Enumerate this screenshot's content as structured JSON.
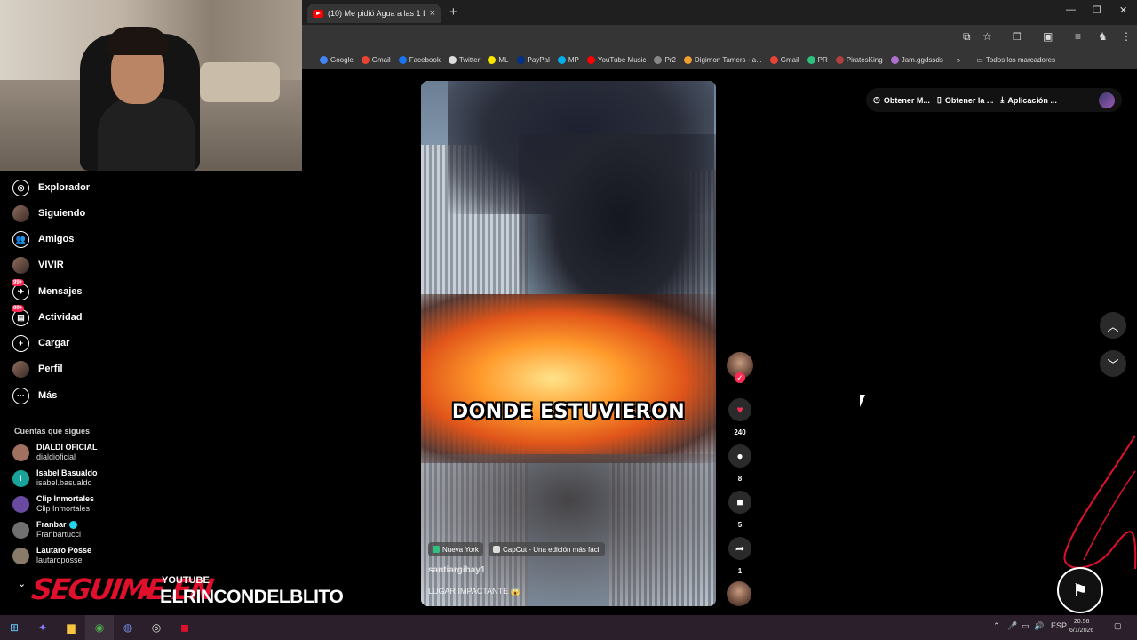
{
  "browser": {
    "tab_title": "(10) Me pidió Agua a las 1 De la",
    "tab_close": "×",
    "new_tab": "+",
    "window_controls": [
      "—",
      "❐",
      "✕"
    ],
    "bookmarks": [
      {
        "label": "Google",
        "color": "#4285f4"
      },
      {
        "label": "Gmail",
        "color": "#ea4335"
      },
      {
        "label": "Facebook",
        "color": "#1877f2"
      },
      {
        "label": "Twitter",
        "color": "#dddddd"
      },
      {
        "label": "ML",
        "color": "#ffe600"
      },
      {
        "label": "PayPal",
        "color": "#003087"
      },
      {
        "label": "MP",
        "color": "#00b1ea"
      },
      {
        "label": "YouTube Music",
        "color": "#ff0000"
      },
      {
        "label": "Pr2",
        "color": "#888888"
      },
      {
        "label": "Digimon Tamers - a...",
        "color": "#f0a030"
      },
      {
        "label": "Gmail",
        "color": "#ea4335"
      },
      {
        "label": "PR",
        "color": "#2ec27e"
      },
      {
        "label": "PiratesKing",
        "color": "#b04040"
      },
      {
        "label": "Jam.ggdssds",
        "color": "#b070d0"
      }
    ],
    "bookmarks_more": "»",
    "all_bookmarks": "Todos los marcadores"
  },
  "sidebar": {
    "items": [
      {
        "label": "Explorador",
        "icon": "compass-icon",
        "glyph": "◎"
      },
      {
        "label": "Siguiendo",
        "icon": "following-avatar-icon",
        "glyph": ""
      },
      {
        "label": "Amigos",
        "icon": "friends-icon",
        "glyph": "👥"
      },
      {
        "label": "VIVIR",
        "icon": "live-avatar-icon",
        "glyph": ""
      },
      {
        "label": "Mensajes",
        "icon": "messages-icon",
        "glyph": "✈",
        "badge": "99+"
      },
      {
        "label": "Actividad",
        "icon": "activity-icon",
        "glyph": "▤",
        "badge": "99+"
      },
      {
        "label": "Cargar",
        "icon": "upload-icon",
        "glyph": "+"
      },
      {
        "label": "Perfil",
        "icon": "profile-avatar-icon",
        "glyph": ""
      },
      {
        "label": "Más",
        "icon": "more-icon",
        "glyph": "···"
      }
    ],
    "following_title": "Cuentas que sigues",
    "accounts": [
      {
        "name": "DIALDI OFICIAL",
        "handle": "dialdioficial",
        "color": "#a07060"
      },
      {
        "name": "Isabel Basualdo",
        "handle": "isabel.basualdo",
        "color": "#1aa39a",
        "initial": "I"
      },
      {
        "name": "Clip Inmortales",
        "handle": "Clip Inmortales",
        "color": "#6a4aa0"
      },
      {
        "name": "Franbar",
        "handle": "Franbartucci",
        "color": "#707070",
        "verified": true
      },
      {
        "name": "Lautaro Posse",
        "handle": "lautaroposse",
        "color": "#8a7a6a"
      }
    ]
  },
  "overlay": {
    "seguime": "SEGUIME EN",
    "platform": "YOUTUBE",
    "channel": "ELRINCONDELBLITO"
  },
  "video": {
    "caption": "DONDE ESTUVIERON",
    "tags": [
      {
        "label": "Nueva York",
        "color": "#2ec27e"
      },
      {
        "label": "CapCut - Una edición más fácil",
        "color": "#dddddd"
      }
    ],
    "author": "santiargibay1",
    "description": "LUGAR IMPACTANTE 😱"
  },
  "actions": {
    "likes": "240",
    "comments": "8",
    "saves": "5",
    "shares": "1"
  },
  "top_actions": {
    "get_coins": "Obtener M...",
    "get_app": "Obtener la ...",
    "desktop_app": "Aplicación ..."
  },
  "taskbar": {
    "lang": "ESP",
    "time": "20:56",
    "date": "6/1/2026"
  }
}
